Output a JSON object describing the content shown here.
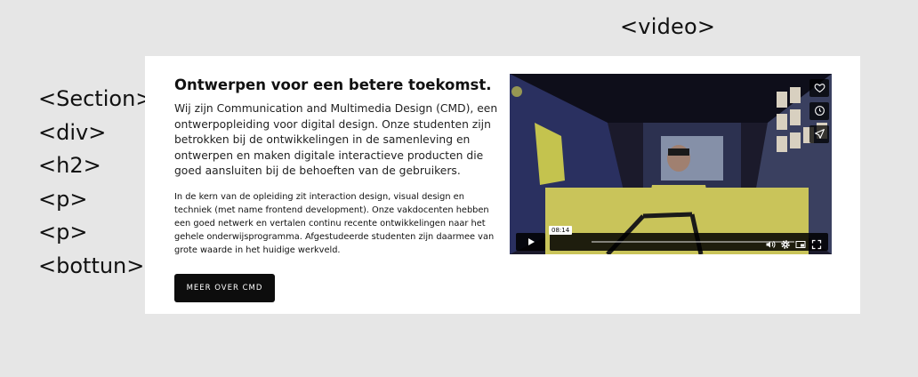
{
  "annotations": {
    "video": "<video>",
    "tags": [
      "<Section>",
      "<div>",
      "<h2>",
      "<p>",
      "<p>",
      "<bottun>"
    ]
  },
  "section": {
    "heading": "Ontwerpen voor een betere toekomst.",
    "paragraph1": "Wij zijn Communication and Multimedia Design (CMD), een ontwerpopleiding voor digital design. Onze studenten zijn betrokken bij de ontwikkelingen in de samenleving en ontwerpen en maken digitale interactieve producten die goed aansluiten bij de behoeften van de gebruikers.",
    "paragraph2": "In de kern van de opleiding zit interaction design, visual design en techniek (met name frontend development). Onze vakdocenten hebben een goed netwerk en vertalen continu recente ontwikkelingen naar het gehele onderwijsprogramma. Afgestudeerde studenten zijn daarmee van grote waarde in het huidige werkveld.",
    "button_label": "MEER OVER CMD"
  },
  "video": {
    "timestamp": "08:14",
    "progress": 0,
    "side_icons": [
      "heart-icon",
      "clock-icon",
      "send-icon"
    ],
    "control_icons": [
      "play-icon",
      "volume-icon",
      "settings-icon",
      "pip-icon",
      "fullscreen-icon"
    ],
    "accent_color": "#c9c45a"
  }
}
